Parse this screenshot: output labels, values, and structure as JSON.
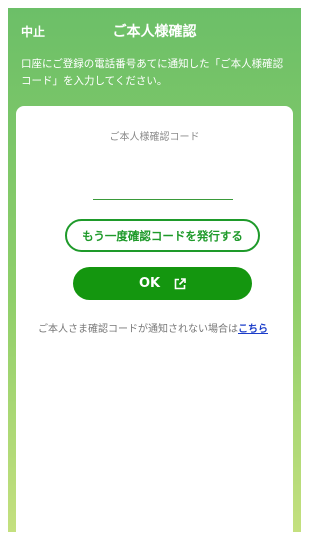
{
  "header": {
    "cancel_label": "中止",
    "title": "ご本人様確認"
  },
  "instruction": "口座にご登録の電話番号あてに通知した「ご本人様確認コード」を入力してください。",
  "form": {
    "code_label": "ご本人様確認コード",
    "code_value": "",
    "resend_label": "もう一度確認コードを発行する",
    "ok_label": "OK",
    "ok_icon": "external-link-icon"
  },
  "note": {
    "text": "ご本人さま確認コードが通知されない場合は",
    "link_label": "こちら"
  },
  "colors": {
    "accent": "#14960f",
    "link": "#1a3cc9",
    "background_top": "#6cbf68",
    "background_bottom": "#c4e07f"
  }
}
